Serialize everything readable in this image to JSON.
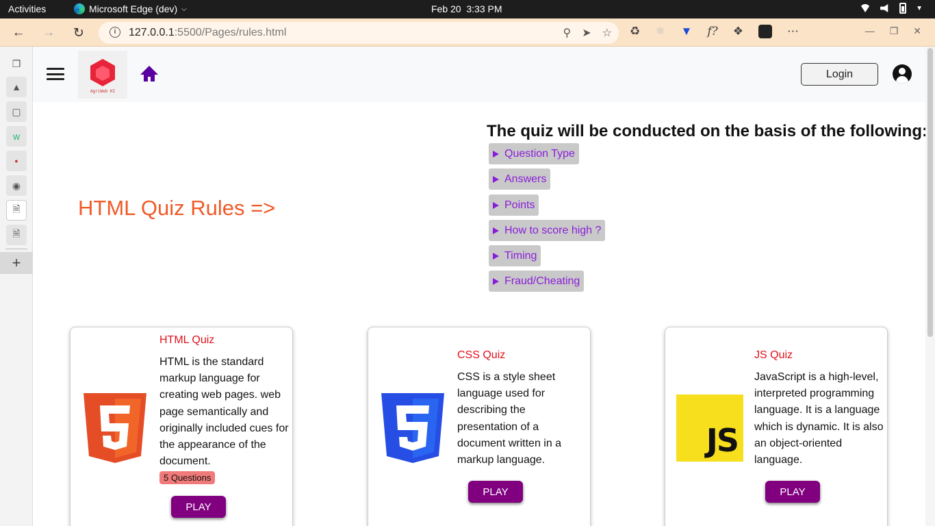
{
  "os": {
    "activities": "Activities",
    "app_name": "Microsoft Edge (dev)",
    "date": "Feb 20",
    "time": "3:33 PM"
  },
  "browser": {
    "url_host": "127.0.0.1",
    "url_rest": ":5500/Pages/rules.html",
    "ext_f_label": "f?"
  },
  "header": {
    "logo_text": "AgriWeb HI",
    "login_label": "Login"
  },
  "main": {
    "title": "HTML Quiz Rules =>",
    "basis_heading": "The quiz will be conducted on the basis of the following:",
    "rules": [
      {
        "label": "Question Type"
      },
      {
        "label": "Answers"
      },
      {
        "label": "Points"
      },
      {
        "label": "How to score high ?"
      },
      {
        "label": "Timing"
      },
      {
        "label": "Fraud/Cheating"
      }
    ]
  },
  "cards": [
    {
      "title": "HTML Quiz",
      "description": "HTML is the standard markup language for creating web pages. web page semantically and originally included cues for the appearance of the document.",
      "badge": "5 Questions",
      "play": "PLAY"
    },
    {
      "title": "CSS Quiz",
      "description": "CSS is a style sheet language used for describing the presentation of a document written in a markup language.",
      "play": "PLAY"
    },
    {
      "title": "JS Quiz",
      "description": "JavaScript is a high-level, interpreted programming language. It is a language which is dynamic. It is also an object-oriented language.",
      "play": "PLAY",
      "logo_text": "JS"
    }
  ],
  "colors": {
    "accent_orange": "#f05a28",
    "link_purple": "#8a1ed8",
    "play_purple": "#800080",
    "card_title_red": "#e0101a"
  }
}
